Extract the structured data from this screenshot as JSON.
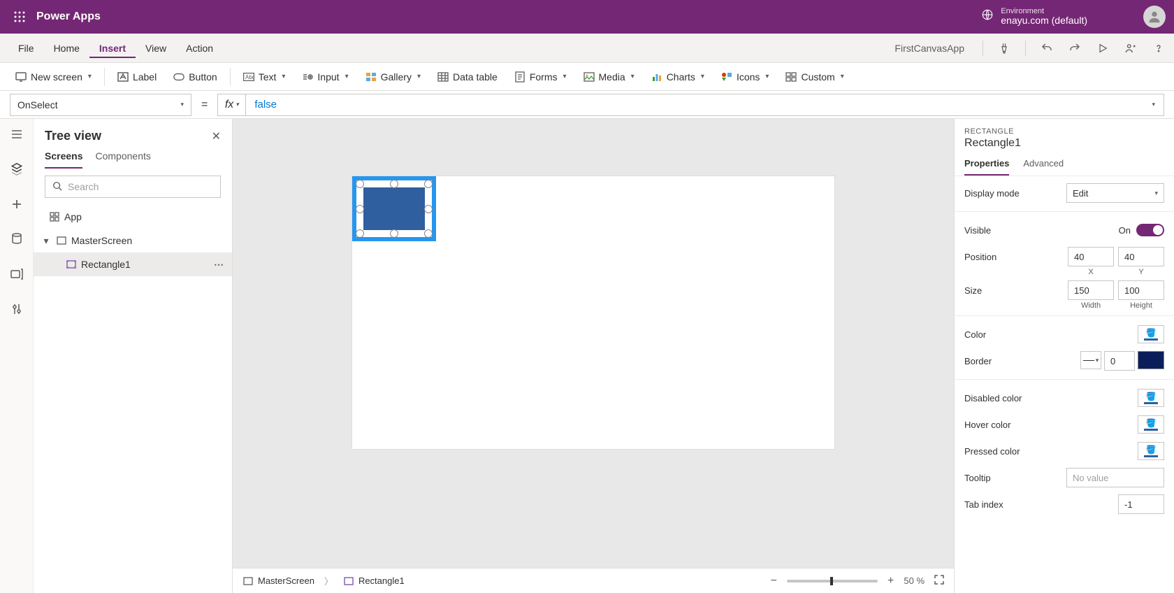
{
  "header": {
    "app_title": "Power Apps",
    "env_label": "Environment",
    "env_name": "enayu.com (default)"
  },
  "menubar": {
    "items": [
      "File",
      "Home",
      "Insert",
      "View",
      "Action"
    ],
    "active": "Insert",
    "app_name": "FirstCanvasApp"
  },
  "ribbon": {
    "new_screen": "New screen",
    "label": "Label",
    "button": "Button",
    "text": "Text",
    "input": "Input",
    "gallery": "Gallery",
    "data_table": "Data table",
    "forms": "Forms",
    "media": "Media",
    "charts": "Charts",
    "icons": "Icons",
    "custom": "Custom"
  },
  "formula": {
    "property": "OnSelect",
    "value": "false"
  },
  "tree": {
    "title": "Tree view",
    "tabs": {
      "screens": "Screens",
      "components": "Components"
    },
    "search_placeholder": "Search",
    "app": "App",
    "screen": "MasterScreen",
    "rect": "Rectangle1"
  },
  "breadcrumb": {
    "screen": "MasterScreen",
    "rect": "Rectangle1"
  },
  "zoom": {
    "value": "50",
    "unit": "%"
  },
  "props": {
    "type_label": "RECTANGLE",
    "name": "Rectangle1",
    "tabs": {
      "properties": "Properties",
      "advanced": "Advanced"
    },
    "display_mode_label": "Display mode",
    "display_mode_value": "Edit",
    "visible_label": "Visible",
    "visible_value": "On",
    "position_label": "Position",
    "pos_x": "40",
    "pos_y": "40",
    "pos_x_label": "X",
    "pos_y_label": "Y",
    "size_label": "Size",
    "width": "150",
    "height": "100",
    "width_label": "Width",
    "height_label": "Height",
    "color_label": "Color",
    "border_label": "Border",
    "border_width": "0",
    "disabled_label": "Disabled color",
    "hover_label": "Hover color",
    "pressed_label": "Pressed color",
    "tooltip_label": "Tooltip",
    "tooltip_placeholder": "No value",
    "tabindex_label": "Tab index",
    "tabindex_value": "-1"
  },
  "colors": {
    "accent": "#742774",
    "shape_fill": "#2f5f9e",
    "border_swatch": "#0b1e5b"
  }
}
